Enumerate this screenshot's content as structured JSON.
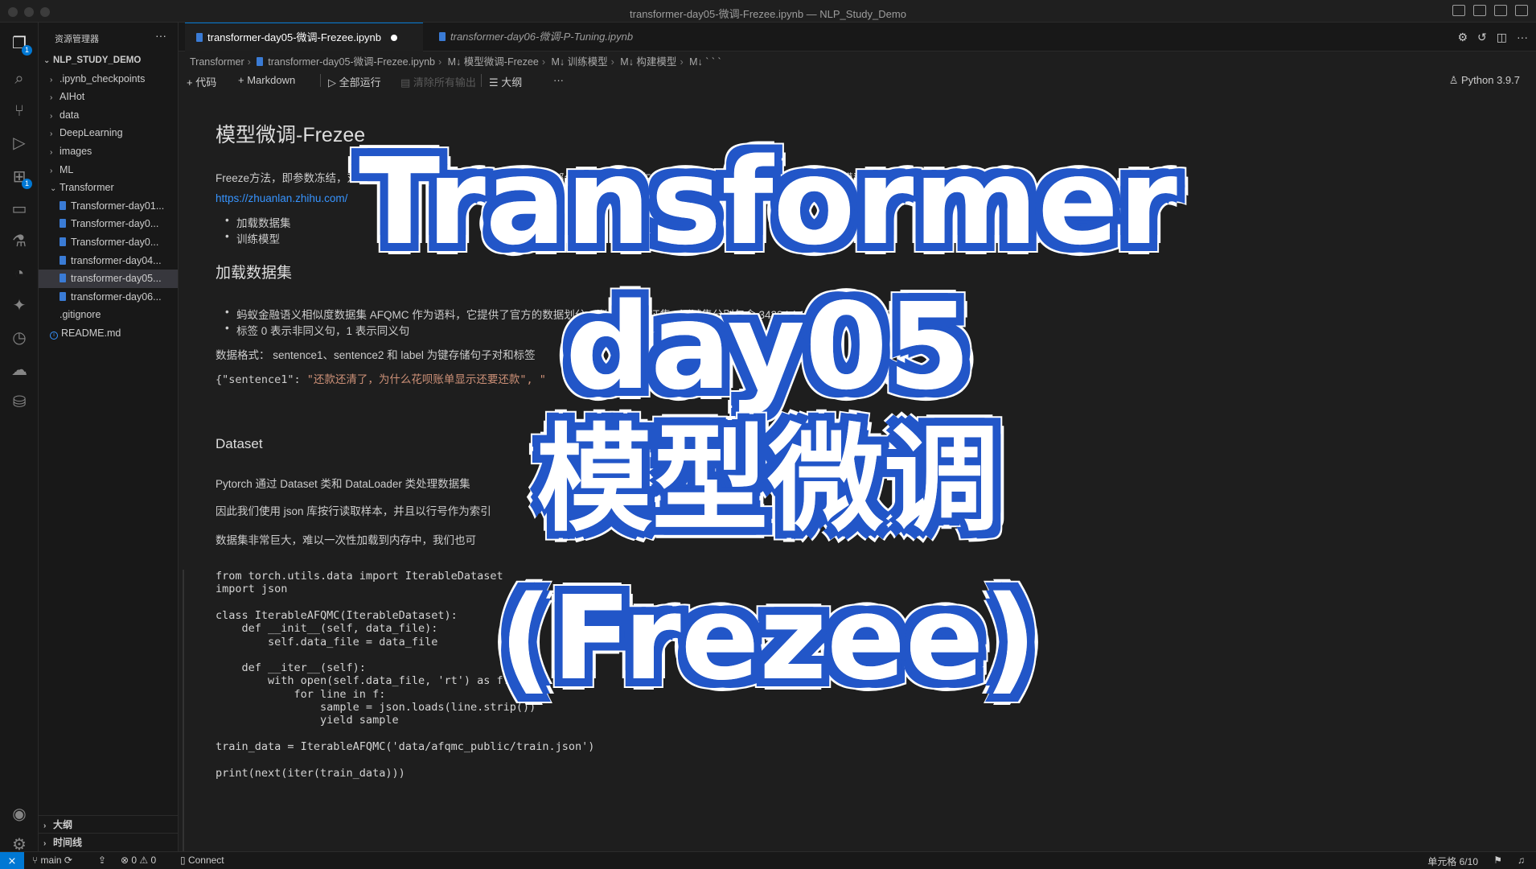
{
  "window": {
    "title": "transformer-day05-微调-Frezee.ipynb — NLP_Study_Demo"
  },
  "activity_badges": {
    "explorer": "1",
    "extensions": "1"
  },
  "sidebar": {
    "header": "资源管理器",
    "more": "···",
    "root": "NLP_STUDY_DEMO",
    "items": [
      {
        "label": ".ipynb_checkpoints",
        "type": "folder"
      },
      {
        "label": "AIHot",
        "type": "folder"
      },
      {
        "label": "data",
        "type": "folder"
      },
      {
        "label": "DeepLearning",
        "type": "folder"
      },
      {
        "label": "images",
        "type": "folder"
      },
      {
        "label": "ML",
        "type": "folder"
      },
      {
        "label": "Transformer",
        "type": "folder-open"
      },
      {
        "label": "Transformer-day01...",
        "type": "notebook"
      },
      {
        "label": "Transformer-day0...",
        "type": "notebook"
      },
      {
        "label": "Transformer-day0...",
        "type": "notebook"
      },
      {
        "label": "transformer-day04...",
        "type": "notebook"
      },
      {
        "label": "transformer-day05...",
        "type": "notebook",
        "selected": true
      },
      {
        "label": "transformer-day06...",
        "type": "notebook"
      },
      {
        "label": ".gitignore",
        "type": "file"
      },
      {
        "label": "README.md",
        "type": "info"
      }
    ],
    "outline": "大纲",
    "timeline": "时间线"
  },
  "tabs": [
    {
      "label": "transformer-day05-微调-Frezee.ipynb",
      "active": true
    },
    {
      "label": "transformer-day06-微调-P-Tuning.ipynb",
      "active": false
    }
  ],
  "breadcrumb": [
    "Transformer",
    "transformer-day05-微调-Frezee.ipynb",
    "M↓ 模型微调-Frezee",
    "M↓ 训练模型",
    "M↓ 构建模型",
    "M↓ ` ` `"
  ],
  "toolbar": {
    "add_code": "+ 代码",
    "add_markdown": "+ Markdown",
    "run_all": "▷ 全部运行",
    "clear_outputs": "清除所有输出",
    "outline": "☰ 大纲",
    "more": "···",
    "kernel": "Python 3.9.7"
  },
  "notebook": {
    "title": "模型微调-Frezee",
    "intro": "Freeze方法，即参数冻结，对原始模型部分参数进行冻结操作，仅训练部分参数，以达到在单卡或不进行TP或PP操作，就可以对大模型进行训练。",
    "link": "https://zhuanlan.zhihu.com/",
    "bullets1": [
      "加载数据集",
      "训练模型"
    ],
    "section_load": "加载数据集",
    "bullets2": [
      "蚂蚁金融语义相似度数据集 AFQMC 作为语料，它提供了官方的数据划分，训练集 / 验证集 / 测试集分别包含 34334 / 4316 / 3861 个句子对，",
      "标签 0 表示非同义句，1 表示同义句"
    ],
    "data_format": "数据格式： sentence1、sentence2 和 label 为键存储句子对和标签",
    "json_key": "{\"sentence1\": ",
    "json_val": "\"还款还清了，为什么花呗账单显示还要还款\", \"",
    "section_dataset": "Dataset",
    "p1": "Pytorch 通过 Dataset 类和 DataLoader 类处理数据集",
    "p2": "因此我们使用 json 库按行读取样本，并且以行号作为索引",
    "p3": "数据集非常巨大，难以一次性加载到内存中，我们也可",
    "code": [
      "from torch.utils.data import IterableDataset",
      "import json",
      "",
      "class IterableAFQMC(IterableDataset):",
      "    def __init__(self, data_file):",
      "        self.data_file = data_file",
      "",
      "    def __iter__(self):",
      "        with open(self.data_file, 'rt') as f:",
      "            for line in f:",
      "                sample = json.loads(line.strip())",
      "                yield sample",
      "",
      "train_data = IterableAFQMC('data/afqmc_public/train.json')",
      "",
      "print(next(iter(train_data)))"
    ]
  },
  "overlay": {
    "line1": "Transformer",
    "line2": "day05",
    "line3": "模型微调",
    "line4": "(Frezee)"
  },
  "status": {
    "branch": "main",
    "errors": "0",
    "warnings": "0",
    "connect": "Connect",
    "cell": "单元格 6/10"
  },
  "colors": {
    "accent": "#0078d4",
    "overlay_outline": "#2256c8",
    "link": "#3794ff"
  }
}
